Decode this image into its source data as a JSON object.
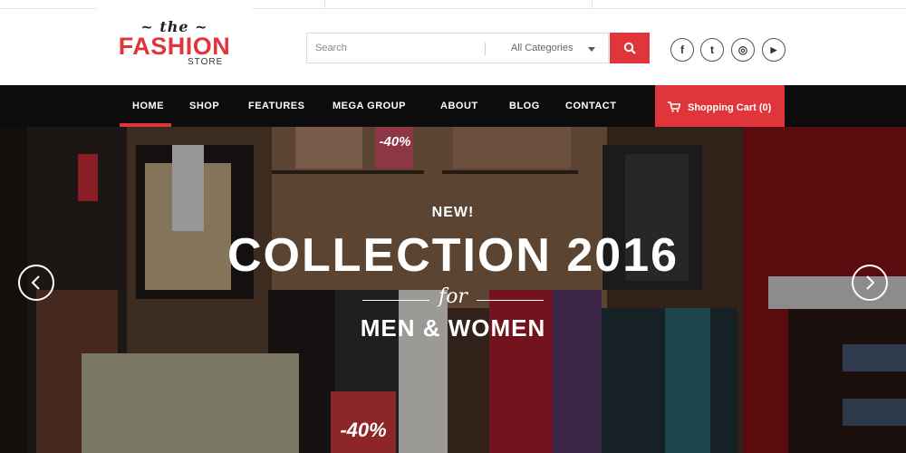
{
  "logo": {
    "the": "~ the ~",
    "fashion": "FASHION",
    "store": "STORE"
  },
  "search": {
    "placeholder": "Search",
    "category": "All Categories"
  },
  "social": {
    "facebook": "f",
    "twitter": "t",
    "instagram": "◎",
    "youtube": "▶"
  },
  "nav": {
    "items": [
      "HOME",
      "SHOP",
      "FEATURES",
      "MEGA GROUP",
      "ABOUT",
      "BLOG",
      "CONTACT"
    ],
    "cart_label": "Shopping Cart (0)"
  },
  "hero": {
    "tag": "NEW!",
    "headline": "COLLECTION 2016",
    "for": "for",
    "sub": "MEN & WOMEN",
    "sale_badge": "-40%"
  },
  "colors": {
    "accent": "#e0363b",
    "nav_bg": "#0c0c0c",
    "hero_bg": "#3a2b22"
  }
}
